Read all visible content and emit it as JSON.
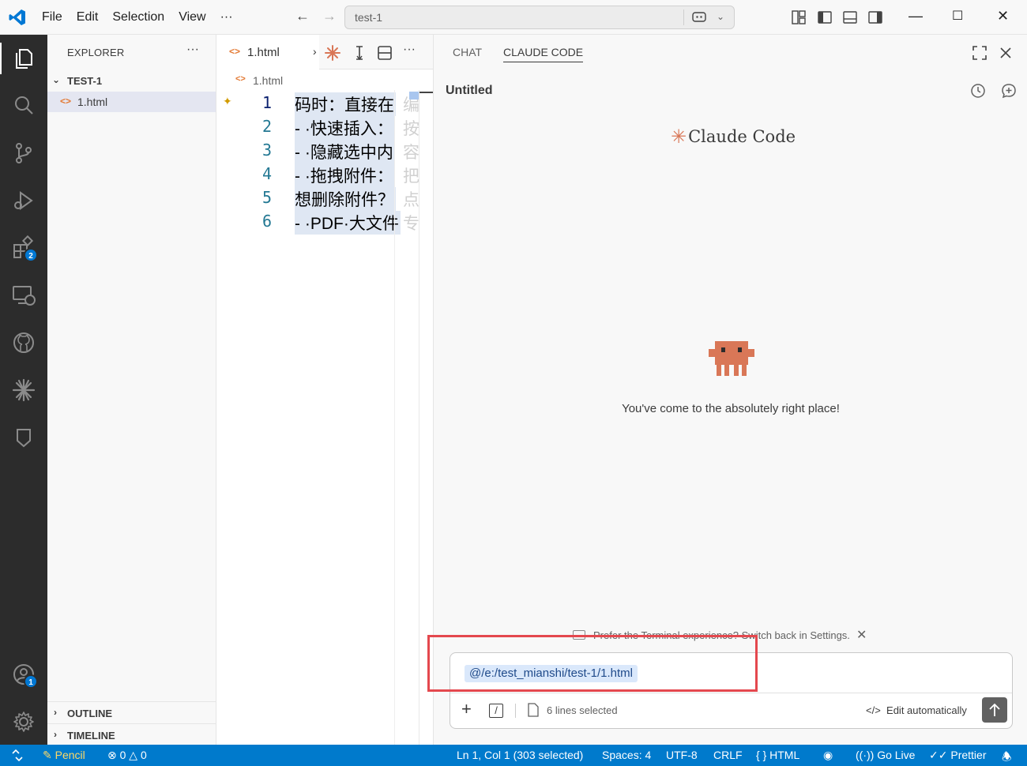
{
  "titlebar": {
    "menu": [
      "File",
      "Edit",
      "Selection",
      "View"
    ],
    "more": "···",
    "search_text": "test-1"
  },
  "activity_bar": {
    "extensions_badge": "2",
    "accounts_badge": "1"
  },
  "explorer": {
    "header": "EXPLORER",
    "more": "···",
    "folder": "TEST-1",
    "file": "1.html",
    "file_icon": "<>",
    "outline": "OUTLINE",
    "timeline": "TIMELINE"
  },
  "editor": {
    "tab_label": "1.html",
    "tab_icon": "<>",
    "breadcrumb": "1.html",
    "lines": [
      {
        "num": "1",
        "text": "码时：直接在",
        "ghost": "编"
      },
      {
        "num": "2",
        "text": "- ·快速插入：",
        "ghost": "按"
      },
      {
        "num": "3",
        "text": "- ·隐藏选中内",
        "ghost": "容"
      },
      {
        "num": "4",
        "text": "- ·拖拽附件：",
        "ghost": "把"
      },
      {
        "num": "5",
        "text": "想删除附件？",
        "ghost": "点"
      },
      {
        "num": "6",
        "text": "- ·PDF·大文件",
        "ghost": "专"
      }
    ]
  },
  "panel": {
    "tabs": [
      "CHAT",
      "CLAUDE CODE"
    ],
    "title": "Untitled",
    "logo_text": "Claude Code",
    "welcome": "You've come to the absolutely right place!",
    "preference": "Prefer the Terminal experience? Switch back in Settings.",
    "input": {
      "mention": "@/e:/test_mianshi/test-1/1.html",
      "selection": "6 lines selected",
      "edit_mode": "Edit automatically",
      "slash": "/"
    }
  },
  "statusbar": {
    "pencil": "Pencil",
    "errors": "0",
    "warnings": "0",
    "position": "Ln 1, Col 1 (303 selected)",
    "spaces": "Spaces: 4",
    "encoding": "UTF-8",
    "eol": "CRLF",
    "language": "HTML",
    "go_live": "Go Live",
    "prettier": "Prettier"
  },
  "colors": {
    "accent": "#007acc",
    "claude": "#d97757",
    "highlight": "#e4484e"
  }
}
